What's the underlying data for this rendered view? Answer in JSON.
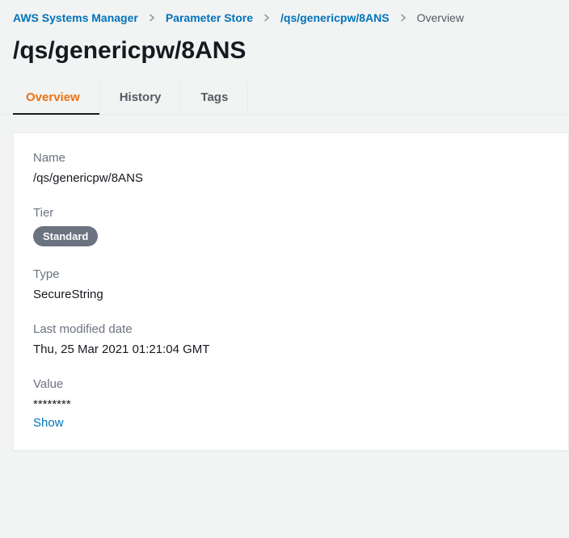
{
  "breadcrumb": {
    "items": [
      {
        "label": "AWS Systems Manager"
      },
      {
        "label": "Parameter Store"
      },
      {
        "label": "/qs/genericpw/8ANS"
      }
    ],
    "current": "Overview"
  },
  "page_title": "/qs/genericpw/8ANS",
  "tabs": {
    "overview": "Overview",
    "history": "History",
    "tags": "Tags"
  },
  "details": {
    "name_label": "Name",
    "name_value": "/qs/genericpw/8ANS",
    "tier_label": "Tier",
    "tier_value": "Standard",
    "type_label": "Type",
    "type_value": "SecureString",
    "last_modified_label": "Last modified date",
    "last_modified_value": "Thu, 25 Mar 2021 01:21:04 GMT",
    "value_label": "Value",
    "value_masked": "********",
    "show_label": "Show"
  }
}
